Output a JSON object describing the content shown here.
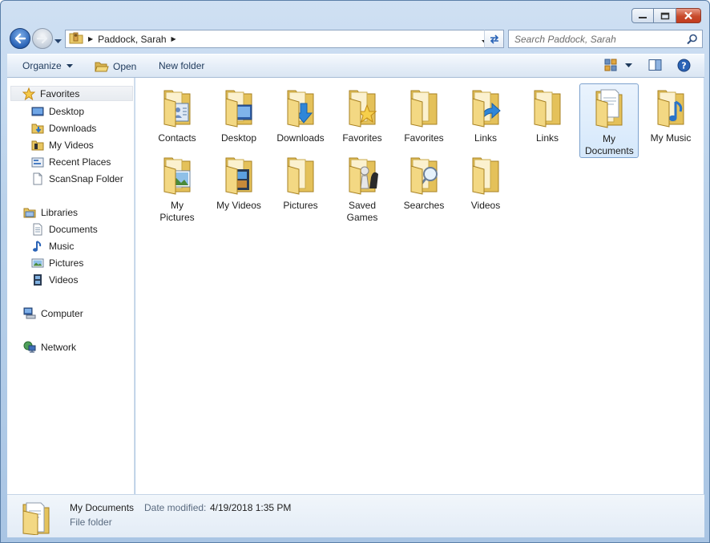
{
  "window": {
    "caption_buttons": [
      "minimize",
      "maximize",
      "close"
    ]
  },
  "address": {
    "crumbs": [
      "Paddock, Sarah"
    ],
    "search_placeholder": "Search Paddock, Sarah"
  },
  "toolbar": {
    "organize_label": "Organize",
    "open_label": "Open",
    "new_folder_label": "New folder"
  },
  "navpane": {
    "favorites": {
      "label": "Favorites",
      "items": [
        {
          "label": "Desktop",
          "icon": "desktop-icon"
        },
        {
          "label": "Downloads",
          "icon": "downloads-folder-icon"
        },
        {
          "label": "My Videos",
          "icon": "videos-folder-icon"
        },
        {
          "label": "Recent Places",
          "icon": "recent-places-icon"
        },
        {
          "label": "ScanSnap Folder",
          "icon": "document-icon"
        }
      ]
    },
    "libraries": {
      "label": "Libraries",
      "items": [
        {
          "label": "Documents",
          "icon": "documents-library-icon"
        },
        {
          "label": "Music",
          "icon": "music-note-icon"
        },
        {
          "label": "Pictures",
          "icon": "pictures-library-icon"
        },
        {
          "label": "Videos",
          "icon": "film-strip-icon"
        }
      ]
    },
    "computer": {
      "label": "Computer"
    },
    "network": {
      "label": "Network"
    }
  },
  "content": {
    "items": [
      {
        "label": "Contacts",
        "overlay": "contact-card"
      },
      {
        "label": "Desktop",
        "overlay": "monitor"
      },
      {
        "label": "Downloads",
        "overlay": "down-arrow"
      },
      {
        "label": "Favorites",
        "overlay": "star"
      },
      {
        "label": "Favorites",
        "overlay": "none"
      },
      {
        "label": "Links",
        "overlay": "shortcut-arrow"
      },
      {
        "label": "Links",
        "overlay": "none"
      },
      {
        "label": "My Documents",
        "overlay": "document",
        "selected": true
      },
      {
        "label": "My Music",
        "overlay": "music-note"
      },
      {
        "label": "My Pictures",
        "overlay": "landscape"
      },
      {
        "label": "My Videos",
        "overlay": "film"
      },
      {
        "label": "Pictures",
        "overlay": "none"
      },
      {
        "label": "Saved Games",
        "overlay": "chess-pieces"
      },
      {
        "label": "Searches",
        "overlay": "magnifier"
      },
      {
        "label": "Videos",
        "overlay": "none"
      }
    ]
  },
  "details": {
    "name": "My Documents",
    "date_label": "Date modified:",
    "date_value": "4/19/2018 1:35 PM",
    "type": "File folder"
  }
}
